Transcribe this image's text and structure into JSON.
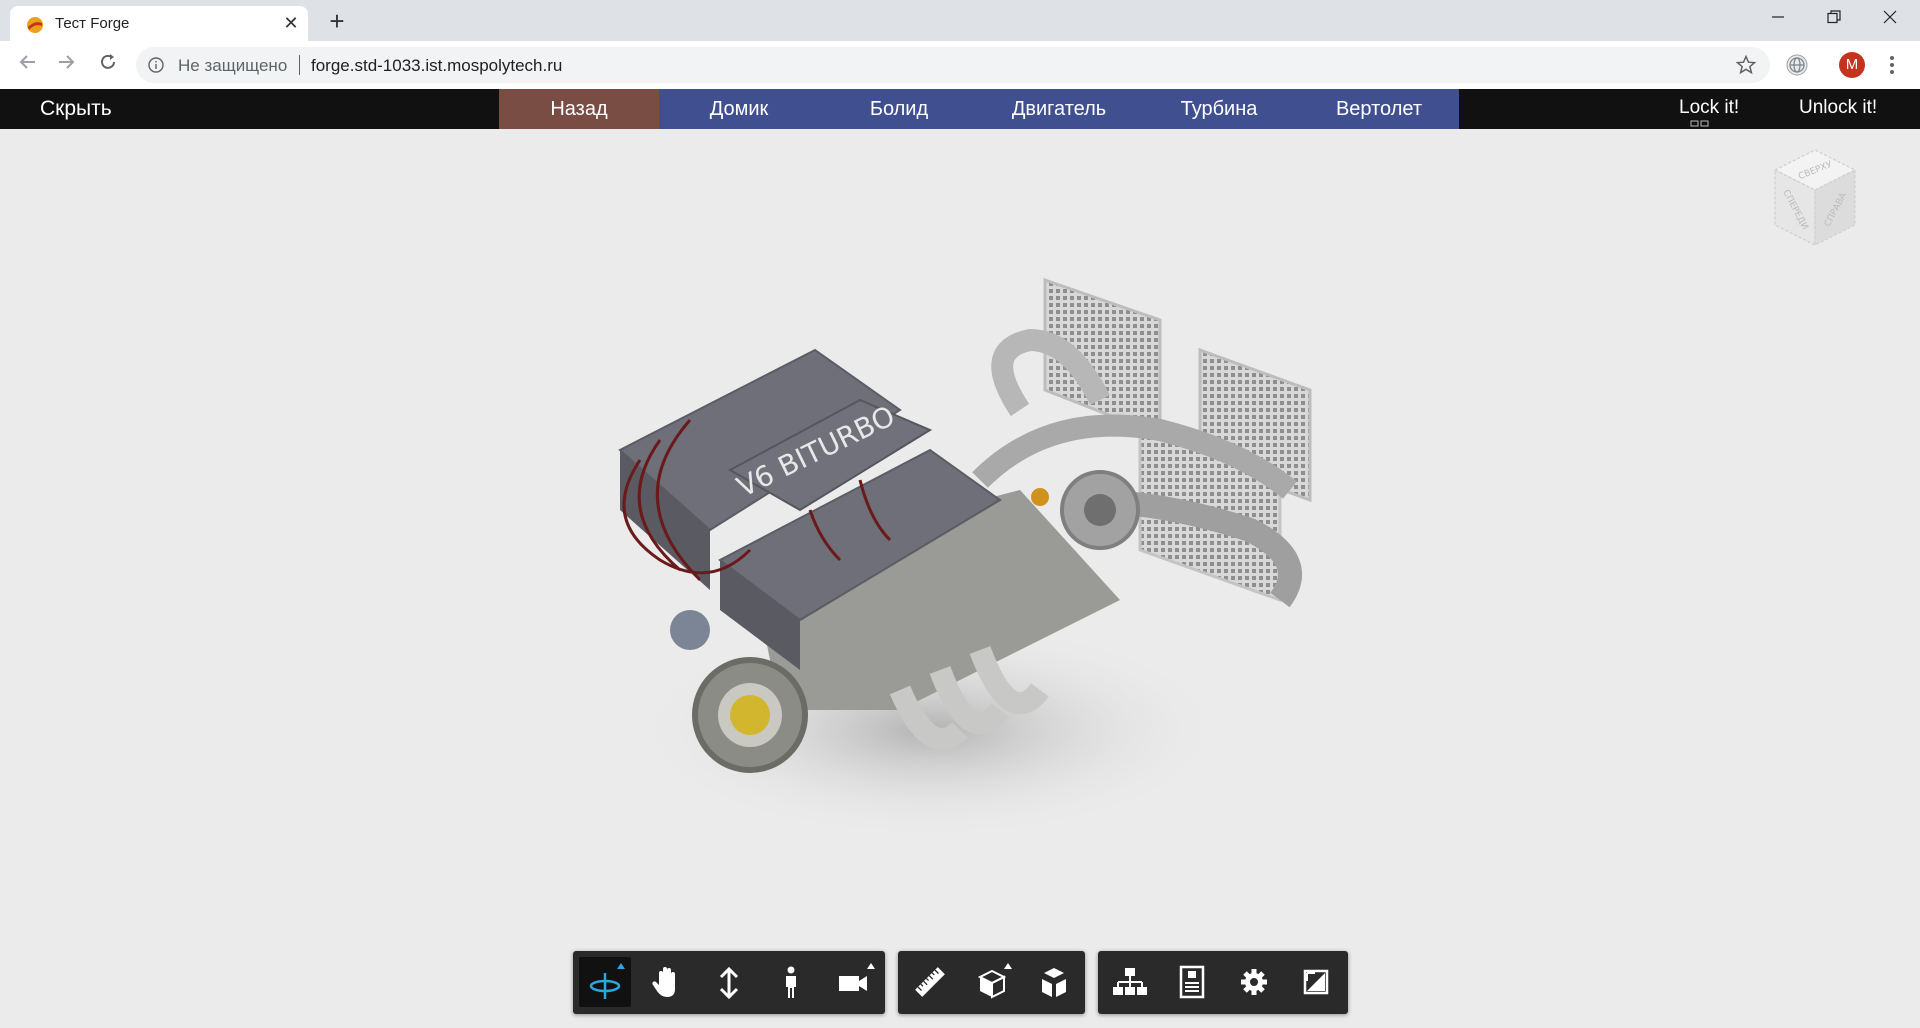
{
  "browser": {
    "tab_title": "Тест Forge",
    "tab_close": "✕",
    "new_tab": "+",
    "not_secure": "Не защищено",
    "url": "forge.std-1033.ist.mospolytech.ru",
    "avatar_letter": "M"
  },
  "appbar": {
    "hide_label": "Скрыть",
    "nav_items": [
      "Назад",
      "Домик",
      "Болид",
      "Двигатель",
      "Турбина",
      "Вертолет"
    ],
    "lock_label": "Lock it!",
    "unlock_label": "Unlock it!"
  },
  "viewcube": {
    "top": "СВЕРХУ",
    "front": "СПЕРЕДИ",
    "right": "СПРАВА"
  },
  "model": {
    "engraving": "V6 BITURBO"
  },
  "toolbar": {
    "groups": [
      [
        "orbit-icon",
        "pan-icon",
        "dolly-icon",
        "first-person-icon",
        "camera-icon"
      ],
      [
        "measure-icon",
        "section-icon",
        "explode-icon"
      ],
      [
        "model-browser-icon",
        "properties-icon",
        "settings-icon",
        "fullscreen-icon"
      ]
    ]
  },
  "colors": {
    "nav_blue": "#3f4f8f",
    "nav_back": "#7a4d44",
    "appbar_bg": "#111111",
    "toolbar_bg": "#2a2a2a",
    "active_tool": "#2aa6e0"
  }
}
